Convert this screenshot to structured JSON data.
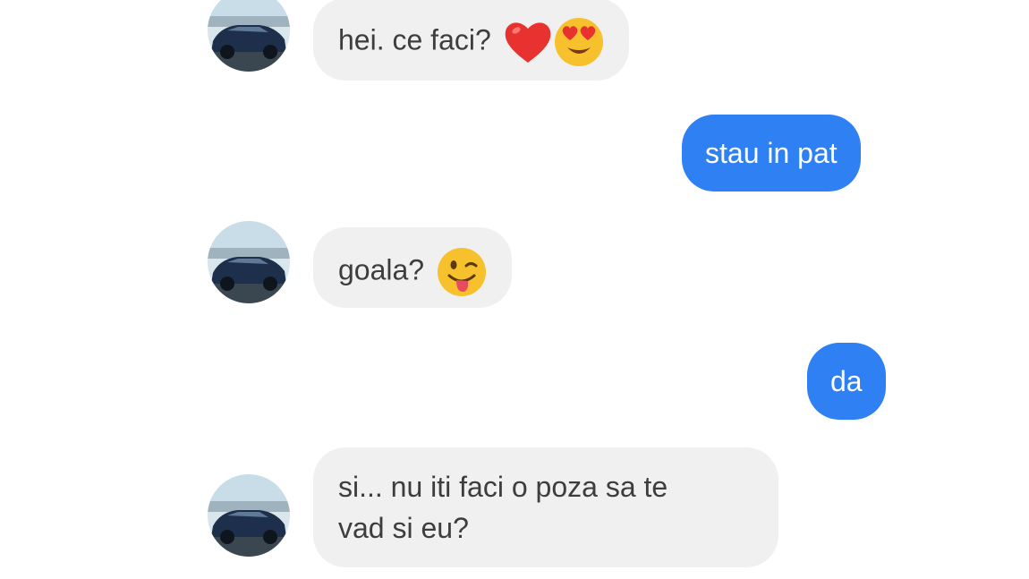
{
  "conversation": {
    "messages": [
      {
        "sender": "contact",
        "text": "hei. ce faci?",
        "emojis": [
          "red-heart",
          "heart-eyes"
        ]
      },
      {
        "sender": "me",
        "text": "stau in pat"
      },
      {
        "sender": "contact",
        "text": "goala?",
        "emojis": [
          "winking-tongue"
        ]
      },
      {
        "sender": "me",
        "text": "da"
      },
      {
        "sender": "contact",
        "lines": [
          "si... nu iti faci o poza sa te",
          "vad si eu?"
        ]
      }
    ]
  },
  "colors": {
    "incoming_bubble": "#f0f0f0",
    "outgoing_bubble": "#2f80f2",
    "incoming_text": "#3d3d3d",
    "outgoing_text": "#ffffff"
  }
}
